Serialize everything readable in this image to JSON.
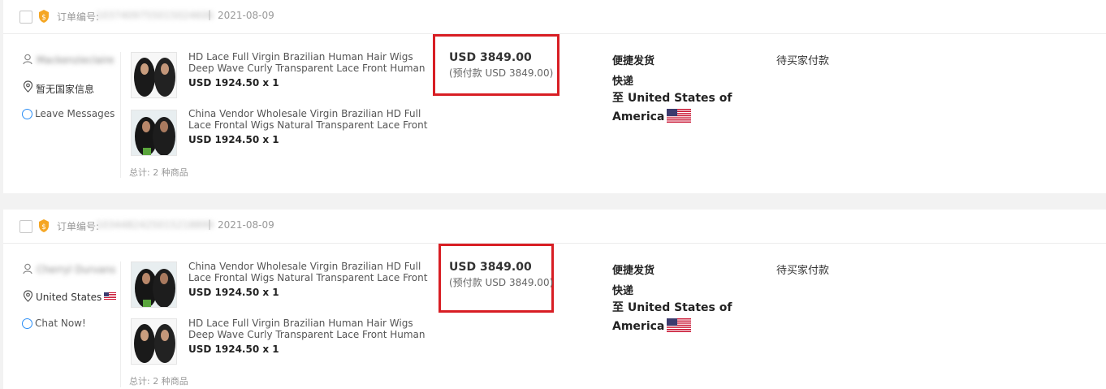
{
  "orders": [
    {
      "order_no_label": "订单编号:",
      "order_no_value": "1037409755015024606",
      "separator": "|",
      "date": "2021-08-09",
      "buyer_name": "Mackenzieclaire",
      "location": "暂无国家信息",
      "location_flag": false,
      "contact": "Leave Messages",
      "products": [
        {
          "name": "HD Lace Full Virgin Brazilian Human Hair Wigs Deep Wave Curly Transparent Lace Front Human Hair Wigs...",
          "price": "USD 1924.50 x 1"
        },
        {
          "name": "China Vendor Wholesale Virgin Brazilian HD Full Lace Frontal Wigs Natural Transparent Lace Front Human...",
          "price": "USD 1924.50 x 1"
        }
      ],
      "total": "总计: 2 种商品",
      "amount": "USD 3849.00",
      "amount_prepay": "(预付款 USD 3849.00)",
      "ship_method": "便捷发货",
      "ship_carrier": "快递",
      "ship_dest": "至 United States of America",
      "status": "待买家付款"
    },
    {
      "order_no_label": "订单编号:",
      "order_no_value": "1034482425015218899",
      "separator": "|",
      "date": "2021-08-09",
      "buyer_name": "Cherryl Durvans",
      "location": "United States",
      "location_flag": true,
      "contact": "Chat Now!",
      "products": [
        {
          "name": "China Vendor Wholesale Virgin Brazilian HD Full Lace Frontal Wigs Natural Transparent Lace Front Human...",
          "price": "USD 1924.50 x 1"
        },
        {
          "name": "HD Lace Full Virgin Brazilian Human Hair Wigs Deep Wave Curly Transparent Lace Front Human Hair Wigs...",
          "price": "USD 1924.50 x 1"
        }
      ],
      "total": "总计: 2 种商品",
      "amount": "USD 3849.00",
      "amount_prepay": "(预付款 USD 3849.00)",
      "ship_method": "便捷发货",
      "ship_carrier": "快递",
      "ship_dest": "至 United States of America",
      "status": "待买家付款"
    }
  ],
  "colors": {
    "highlight_border": "#d81e24",
    "chat_icon": "#2c8ef5",
    "vip_badge": "#f5a623"
  },
  "icons": [
    "checkbox",
    "vip-badge-icon",
    "user-icon",
    "location-pin-icon",
    "chat-icon",
    "us-flag-icon",
    "wig-product-thumbnail"
  ]
}
